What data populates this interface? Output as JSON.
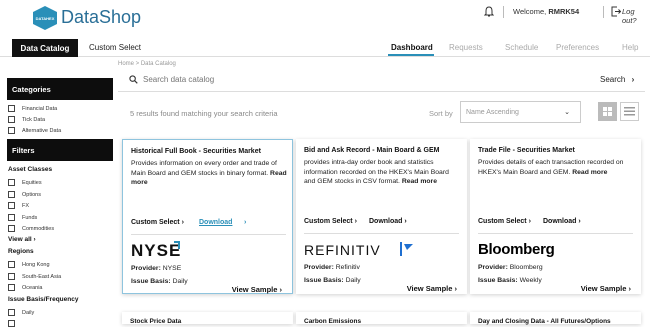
{
  "app": {
    "logo_badge": "DATAHEX",
    "name": "DataShop"
  },
  "header": {
    "welcome_prefix": "Welcome,",
    "username": "RMRK54",
    "logout": "Log out?"
  },
  "nav": {
    "left_tabs": [
      "Data Catalog",
      "Custom Select"
    ],
    "right_tabs": [
      "Dashboard",
      "Requests",
      "Schedule",
      "Preferences",
      "Help"
    ],
    "active": "Dashboard"
  },
  "breadcrumb": "Home > Data Catalog",
  "search": {
    "placeholder": "Search data catalog",
    "button": "Search"
  },
  "results_text": "5 results found matching your search criteria",
  "sort": {
    "label": "Sort by",
    "value": "Name Ascending"
  },
  "sidebar": {
    "categories_title": "Categories",
    "categories": [
      "Financial Data",
      "Tick Data",
      "Alternative Data"
    ],
    "filters_title": "Filters",
    "asset_title": "Asset Classes",
    "assets": [
      "Equities",
      "Options",
      "FX",
      "Funds",
      "Commodities"
    ],
    "view_all": "View all",
    "regions_title": "Regions",
    "regions": [
      "Hong Kong",
      "South-East Asia",
      "Oceania"
    ],
    "basis_title": "Issue Basis/Frequency",
    "basis": [
      "Daily"
    ]
  },
  "cards": [
    {
      "title": "Historical Full Book - Securities Market",
      "desc": "Provides information on every order and trade of Main Board and GEM stocks in binary format.",
      "read_more": "Read more",
      "custom": "Custom Select",
      "download": "Download",
      "brand": "NYSE",
      "provider_label": "Provider:",
      "provider": "NYSE",
      "basis_label": "Issue Basis:",
      "basis": "Daily",
      "sample": "View Sample"
    },
    {
      "title": "Bid and Ask Record - Main Board & GEM",
      "desc": "provides intra-day order book and statistics information recorded on the HKEX's Main Board and GEM stocks in CSV format.",
      "read_more": "Read more",
      "custom": "Custom Select",
      "download": "Download",
      "brand": "REFINITIV",
      "provider_label": "Provider:",
      "provider": "Refinitiv",
      "basis_label": "Issue Basis:",
      "basis": "Daily",
      "sample": "View Sample"
    },
    {
      "title": "Trade File - Securities Market",
      "desc": "Provides details of each transaction recorded on HKEX's Main Board and GEM.",
      "read_more": "Read more",
      "custom": "Custom Select",
      "download": "Download",
      "brand": "Bloomberg",
      "provider_label": "Provider:",
      "provider": "Bloomberg",
      "basis_label": "Issue Basis:",
      "basis": "Weekly",
      "sample": "View Sample"
    }
  ],
  "more_cards": [
    "Stock Price Data",
    "Carbon Emissions",
    "Day and Closing Data - All Futures/Options"
  ],
  "colors": {
    "accent": "#2a8fb8",
    "dark": "#0d0d0d",
    "refinitiv_blue": "#1f6fd0"
  }
}
